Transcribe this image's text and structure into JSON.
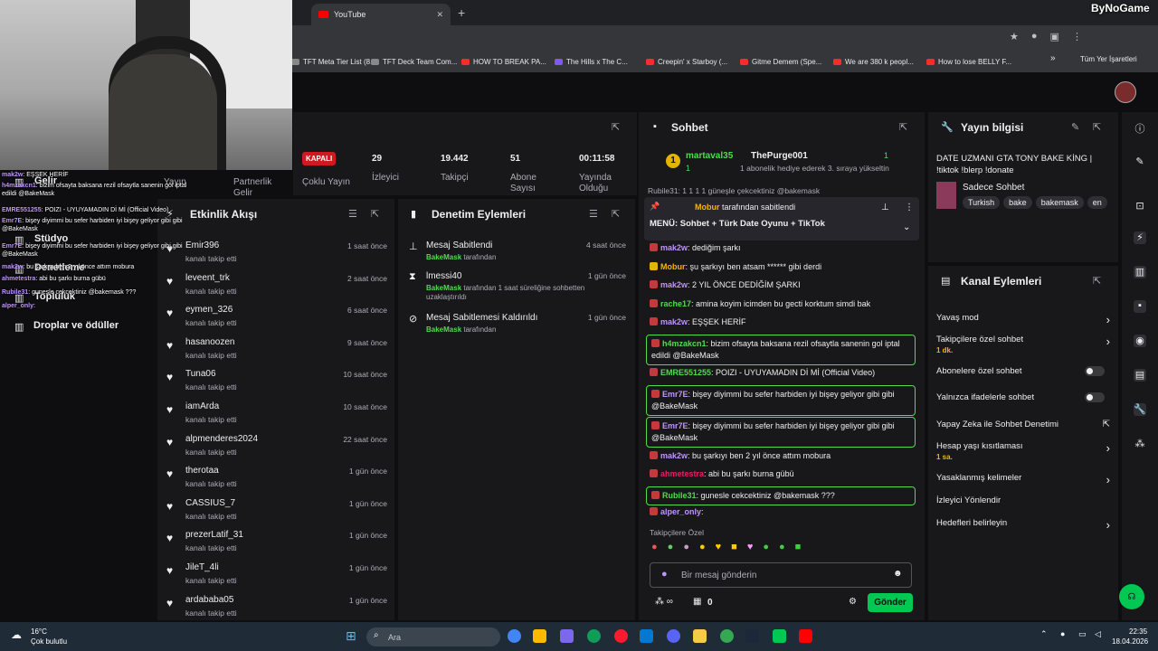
{
  "browser": {
    "tab_title": "YouTube",
    "tab_close": "✕",
    "new_tab": "+",
    "bookmarks": [
      {
        "label": "TFT Meta Tier List (8...",
        "icon": "globe"
      },
      {
        "label": "TFT Deck Team Com...",
        "icon": "globe"
      },
      {
        "label": "HOW TO BREAK PA...",
        "icon": "youtube"
      },
      {
        "label": "The Hills x The C...",
        "icon": "twitch"
      },
      {
        "label": "Creepin' x Starboy (...",
        "icon": "youtube"
      },
      {
        "label": "Gitme Demem (Spe...",
        "icon": "youtube"
      },
      {
        "label": "We are 380 k peopl...",
        "icon": "youtube"
      },
      {
        "label": "How to lose BELLY F...",
        "icon": "youtube"
      }
    ],
    "bookmarks_more": "»",
    "all_bookmarks": "Tüm Yer İşaretleri"
  },
  "logo": "ByNoGame",
  "stats": {
    "status_badge": "KAPALI",
    "items": [
      {
        "value": "29",
        "label": "İzleyici"
      },
      {
        "value": "19.442",
        "label": "Takipçi"
      },
      {
        "value": "51",
        "label": "Abone Sayısı"
      },
      {
        "value": "00:11:58",
        "label": "Yayında Olduğu"
      }
    ],
    "left_labels": [
      "Yayın",
      "Partnerlik Gelir",
      "Çoklu Yayın"
    ]
  },
  "activity": {
    "title": "Etkinlik Akışı",
    "subtitle": "kanalı takip etti",
    "rows": [
      {
        "name": "Emir396",
        "time": "1 saat önce"
      },
      {
        "name": "leveent_trk",
        "time": "2 saat önce"
      },
      {
        "name": "eymen_326",
        "time": "6 saat önce"
      },
      {
        "name": "hasanoozen",
        "time": "9 saat önce"
      },
      {
        "name": "Tuna06",
        "time": "10 saat önce"
      },
      {
        "name": "iamArda",
        "time": "10 saat önce"
      },
      {
        "name": "alpmenderes2024",
        "time": "22 saat önce"
      },
      {
        "name": "therotaa",
        "time": "1 gün önce"
      },
      {
        "name": "CASSIUS_7",
        "time": "1 gün önce"
      },
      {
        "name": "prezerLatif_31",
        "time": "1 gün önce"
      },
      {
        "name": "JileT_4li",
        "time": "1 gün önce"
      },
      {
        "name": "ardababa05",
        "time": "1 gün önce"
      }
    ]
  },
  "moderation": {
    "title": "Denetim Eylemleri",
    "rows": [
      {
        "title": "Mesaj Sabitlendi",
        "actor": "BakeMask",
        "detail": "tarafından",
        "time": "4 saat önce",
        "icon": "pin"
      },
      {
        "title": "lmessi40",
        "actor": "BakeMask",
        "detail": "tarafından 1 saat süreliğine sohbetten uzaklaştırıldı",
        "time": "1 gün önce",
        "icon": "hourglass"
      },
      {
        "title": "Mesaj Sabitlemesi Kaldırıldı",
        "actor": "BakeMask",
        "detail": "tarafından",
        "time": "1 gün önce",
        "icon": "unpin"
      }
    ]
  },
  "chat": {
    "title": "Sohbet",
    "gift_user": "martaval35",
    "gift_count": "1",
    "gift_target": "ThePurge001",
    "gift_target_count": "1",
    "gift_text": "1 abonelik hediye ederek 3. sıraya yükseltin",
    "partial_line": "Rubile31: 1 1 1 1 güneşle çekcektiniz @bakemask",
    "pinned_by": "Mobur",
    "pinned_by_suffix": "tarafından sabitlendi",
    "pinned_text": "MENÜ: Sohbet + Türk Date Oyunu + TikTok",
    "messages": [
      {
        "user": "mak2w",
        "color": "#bf94ff",
        "text": ": dediğim şarkı",
        "hl": false
      },
      {
        "user": "Mobur",
        "color": "#f7b500",
        "text": ": şu şarkıyı ben atsam ****** gibi derdi",
        "hl": false
      },
      {
        "user": "mak2w",
        "color": "#bf94ff",
        "text": ": 2 YIL ÖNCE DEDİĞİM ŞARKI",
        "hl": false
      },
      {
        "user": "rache17",
        "color": "#4fdc4f",
        "text": ": amina koyim icimden bu gecti korktum simdi bak",
        "hl": false
      },
      {
        "user": "mak2w",
        "color": "#bf94ff",
        "text": ": EŞŞEK HERİF",
        "hl": false
      },
      {
        "user": "h4mzakcn1",
        "color": "#4fdc4f",
        "text": ": bizim ofsayta baksana rezil ofsaytla sanenin gol iptal edildi @BakeMask",
        "hl": true
      },
      {
        "user": "EMRE551255",
        "color": "#4fdc4f",
        "text": ": POIZI - UYUYAMADIN Dİ Mİ (Official Video)",
        "hl": false
      },
      {
        "user": "Emr7E",
        "color": "#bf94ff",
        "text": ": bişey diyimmi bu sefer harbiden iyi bişey geliyor gibi gibi @BakeMask",
        "hl": true
      },
      {
        "user": "Emr7E",
        "color": "#bf94ff",
        "text": ": bişey diyimmi bu sefer harbiden iyi bişey geliyor gibi gibi @BakeMask",
        "hl": true
      },
      {
        "user": "mak2w",
        "color": "#bf94ff",
        "text": ": bu şarkıyı ben 2 yıl önce attım mobura",
        "hl": false
      },
      {
        "user": "ahmetestra",
        "color": "#e91e63",
        "text": ": abi bu şarkı burna gübü",
        "hl": false
      },
      {
        "user": "Rubile31",
        "color": "#4fdc4f",
        "text": ": gunesle cekcektiniz @bakemask ???",
        "hl": true
      },
      {
        "user": "alper_only",
        "color": "#bf94ff",
        "text": ":",
        "hl": false
      }
    ],
    "emote_label": "Takipçilere Özel",
    "input_placeholder": "Bir mesaj gönderin",
    "points": "0",
    "send_label": "Gönder"
  },
  "info": {
    "title": "Yayın bilgisi",
    "stream_title": "DATE UZMANI GTA TONY BAKE KİNG | !tiktok !blerp !donate",
    "category": "Sadece Sohbet",
    "tags": [
      "Turkish",
      "bake",
      "bakemask",
      "en"
    ]
  },
  "actions": {
    "title": "Kanal Eylemleri",
    "items": [
      {
        "label": "Yavaş mod",
        "sub": "",
        "control": "chevron"
      },
      {
        "label": "Takipçilere özel sohbet",
        "sub": "1 dk.",
        "control": "chevron"
      },
      {
        "label": "Abonelere özel sohbet",
        "sub": "",
        "control": "toggle"
      },
      {
        "label": "Yalnızca ifadelerle sohbet",
        "sub": "",
        "control": "toggle"
      },
      {
        "label": "Yapay Zeka ile Sohbet Denetimi",
        "sub": "",
        "control": "external"
      },
      {
        "label": "Hesap yaşı kısıtlaması",
        "sub": "1 sa.",
        "control": "chevron"
      },
      {
        "label": "Yasaklanmış kelimeler",
        "sub": "",
        "control": "chevron"
      },
      {
        "label": "İzleyici Yönlendir",
        "sub": "",
        "control": "none"
      },
      {
        "label": "Hedefleri belirleyin",
        "sub": "",
        "control": "chevron"
      }
    ]
  },
  "sidebar": {
    "items": [
      "Gelir",
      "Stüdyo",
      "Denetleme",
      "Topluluk",
      "Droplar ve ödüller"
    ],
    "overlay_lines": [
      {
        "user": "mak2w",
        "text": ": EŞŞEK HERİF"
      },
      {
        "user": "h4mzakcn1",
        "text": ": bizim ofsayta baksana rezil ofsaytla sanenin gol iptal edildi @BakeMask"
      },
      {
        "user": "EMRE551255",
        "text": ": POIZI - UYUYAMADIN Dİ Mİ (Official Video)"
      },
      {
        "user": "Emr7E",
        "text": ": bişey diyimmi bu sefer harbiden iyi bişey geliyor gibi gibi @BakeMask"
      },
      {
        "user": "Emr7E",
        "text": ": bişey diyimmi bu sefer harbiden iyi bişey geliyor gibi gibi @BakeMask"
      },
      {
        "user": "mak2w",
        "text": ": bu şarkıyı ben 2 yıl önce attım mobura"
      },
      {
        "user": "ahmetestra",
        "text": ": abi bu şarkı burna gübü"
      },
      {
        "user": "Rubile31",
        "text": ": gunesle cekcektiniz @bakemask ???"
      },
      {
        "user": "alper_only",
        "text": ":"
      }
    ]
  },
  "taskbar": {
    "temp": "16°C",
    "weather": "Çok bulutlu",
    "search_placeholder": "Ara",
    "time": "22:35",
    "date": "18.04.2026"
  },
  "colors": {
    "accent": "#00c853",
    "highlight": "#4fdc4f",
    "offline": "#d01820",
    "bg": "#0e0e10",
    "panel": "#18181b"
  }
}
